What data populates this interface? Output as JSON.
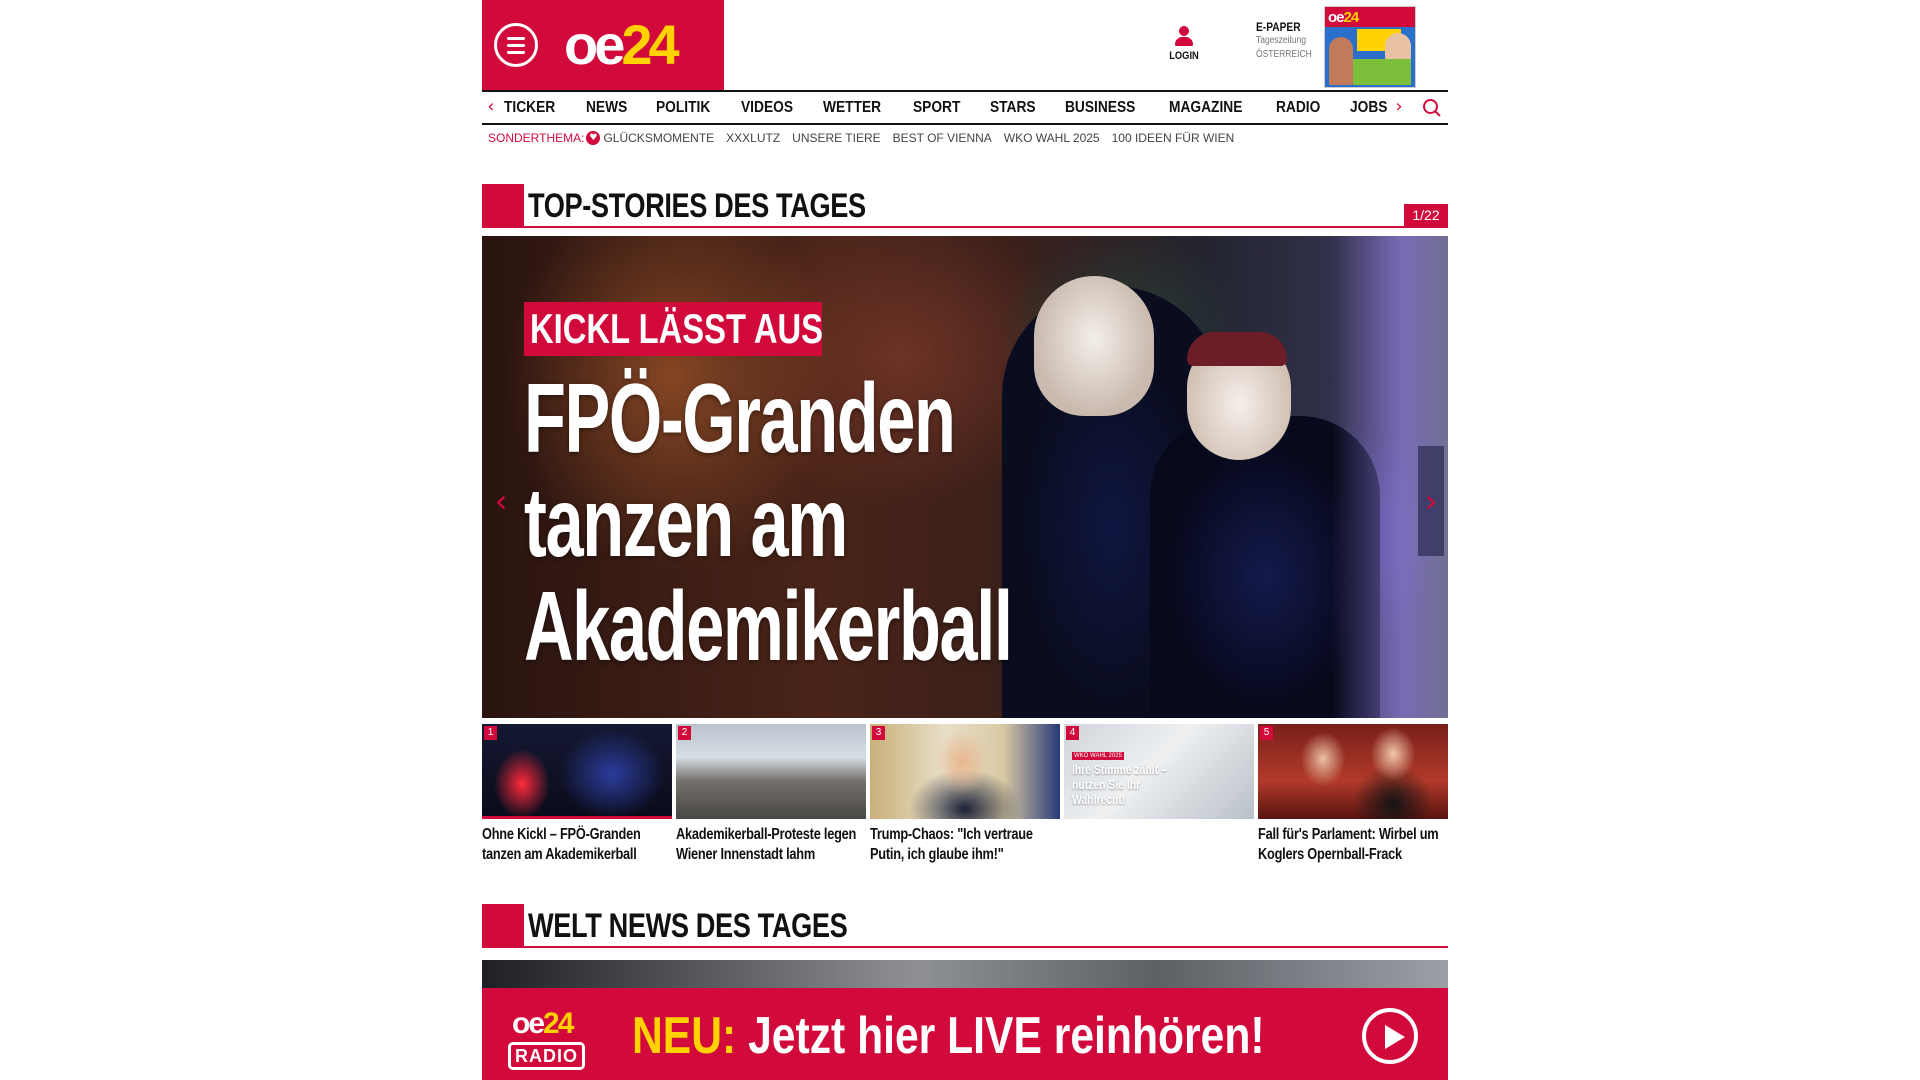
{
  "header": {
    "logo_oe": "oe",
    "logo_num": "24",
    "login_label": "LOGIN",
    "epaper_title": "E-PAPER",
    "epaper_sub1": "Tageszeitung",
    "epaper_sub2": "ÖSTERREICH"
  },
  "nav": {
    "items": [
      "TICKER",
      "NEWS",
      "POLITIK",
      "VIDEOS",
      "WETTER",
      "SPORT",
      "STARS",
      "BUSINESS",
      "MAGAZINE",
      "RADIO",
      "JOBS"
    ],
    "left_arrow": "‹",
    "right_arrow": "›"
  },
  "topics": {
    "label": "SONDERTHEMA:",
    "items": [
      "GLÜCKSMOMENTE",
      "XXXLUTZ",
      "UNSERE TIERE",
      "BEST OF VIENNA",
      "WKO WAHL 2025",
      "100 IDEEN FÜR WIEN"
    ]
  },
  "top_stories": {
    "title": "TOP-STORIES DES TAGES",
    "counter": "1/22",
    "hero": {
      "kicker": "KICKL LÄSST AUS",
      "headline": "FPÖ-Granden tanzen am Akademikerball",
      "prev_arrow": "‹",
      "next_arrow": "›"
    },
    "thumbs": [
      {
        "num": "1",
        "title": "Ohne Kickl – FPÖ-Granden tanzen am Akademikerball"
      },
      {
        "num": "2",
        "title": "Akademikerball-Proteste legen Wiener Innenstadt lahm"
      },
      {
        "num": "3",
        "title": "Trump-Chaos: \"Ich vertraue Putin, ich glaube ihm!\""
      },
      {
        "num": "4",
        "title": "",
        "tag": "WKO WAHL 2025",
        "overlay": "Ihre Stimme zählt – nutzen Sie Ihr Wahlrecht!"
      },
      {
        "num": "5",
        "title": "Fall für's Parlament: Wirbel um Koglers Opernball-Frack"
      }
    ]
  },
  "welt_news": {
    "title": "WELT NEWS DES TAGES"
  },
  "radio_banner": {
    "logo_oe": "oe",
    "logo_num": "24",
    "logo_radio": "RADIO",
    "neu": "NEU:",
    "message": "Jetzt hier LIVE reinhören!"
  },
  "colors": {
    "brand_red": "#d20a3c",
    "brand_yellow": "#ffd200"
  }
}
